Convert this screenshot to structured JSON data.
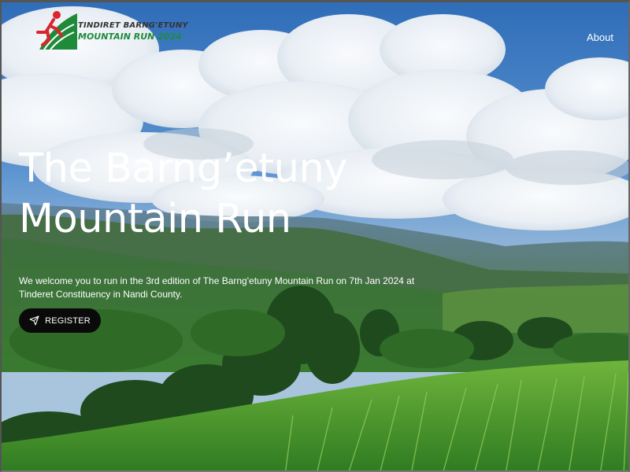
{
  "header": {
    "logo": {
      "line1": "TINDIRET BARNG'ETUNY",
      "line2": "MOUNTAIN RUN 2024",
      "icon": "runner-icon"
    },
    "nav": {
      "about_label": "About"
    }
  },
  "hero": {
    "title_line1": "The Barng’etuny",
    "title_line2": "Mountain Run",
    "subtitle": "We welcome you to run in the 3rd edition of The Barng'etuny Mountain Run on 7th Jan 2024 at Tinderet Constituency in Nandi County.",
    "register_label": "REGISTER",
    "register_icon": "send-icon"
  },
  "colors": {
    "sky": "#3d7fc9",
    "hills": "#2f6a34",
    "grass": "#58a534",
    "button_bg": "#0a0a0a",
    "logo_green": "#1f8a3a",
    "logo_red": "#d8262b"
  }
}
